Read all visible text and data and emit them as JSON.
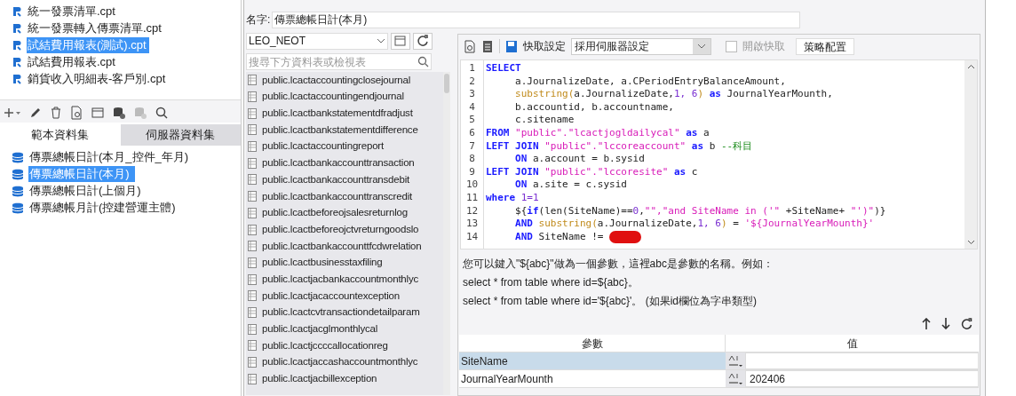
{
  "file_list": [
    {
      "label": "統一發票清單.cpt",
      "selected": false
    },
    {
      "label": "統一發票轉入傳票清單.cpt",
      "selected": false
    },
    {
      "label": "試結費用報表(測試).cpt",
      "selected": true
    },
    {
      "label": "試結費用報表.cpt",
      "selected": false
    },
    {
      "label": "銷貨收入明細表-客戶別.cpt",
      "selected": false
    }
  ],
  "dataset_tabs": [
    {
      "label": "範本資料集",
      "selected": true
    },
    {
      "label": "伺服器資料集",
      "selected": false
    }
  ],
  "datasets": [
    {
      "label": "傳票總帳日計(本月_控件_年月)",
      "selected": false
    },
    {
      "label": "傳票總帳日計(本月)",
      "selected": true
    },
    {
      "label": "傳票總帳日計(上個月)",
      "selected": false
    },
    {
      "label": "傳票總帳月計(控建營運主體)",
      "selected": false
    }
  ],
  "dialog": {
    "name_label": "名字:",
    "name_value": "傳票總帳日計(本月)",
    "connection": "LEO_NEOT",
    "search_placeholder": "搜尋下方資料表或檢視表",
    "tables": [
      "public.lcactaccountingclosejournal",
      "public.lcactaccountingendjournal",
      "public.lcactbankstatementdfradjust",
      "public.lcactbankstatementdifference",
      "public.lcactaccountingreport",
      "public.lcactbankaccounttransaction",
      "public.lcactbankaccounttransdebit",
      "public.lcactbankaccounttranscredit",
      "public.lcactbeforeojsalesreturnlog",
      "public.lcactbeforeojctvreturngoodslo",
      "public.lcactbankaccounttfcdwrelation",
      "public.lcactbusinesstaxfiling",
      "public.lcactjacbankaccountmonthlyc",
      "public.lcactjacaccountexception",
      "public.lcactcvtransactiondetailparam",
      "public.lcactjacglmonthlycal",
      "public.lcactjccccallocationreg",
      "public.lcactjaccashaccountmonthlyc",
      "public.lcactjacbillexception"
    ],
    "cache_label": "快取設定",
    "cache_value": "採用伺服器設定",
    "enable_cache": {
      "label": "開啟快取",
      "checked": false,
      "disabled": true
    },
    "strategy_button": "策略配置",
    "code_lines": [
      {
        "number": "1",
        "segments": [
          {
            "kind": "keyword",
            "text": "SELECT"
          }
        ]
      },
      {
        "number": "2",
        "segments": [
          {
            "kind": "plain",
            "text": "     a.JournalizeDate, a.CPeriodEntryBalanceAmount,"
          }
        ]
      },
      {
        "number": "3",
        "segments": [
          {
            "kind": "func",
            "text": "     substring("
          },
          {
            "kind": "plain",
            "text": "a.JournalizeDate,"
          },
          {
            "kind": "number",
            "text": "1, 6"
          },
          {
            "kind": "func",
            "text": ")"
          },
          {
            "kind": "keyword",
            "text": " as"
          },
          {
            "kind": "plain",
            "text": " JournalYearMounth,"
          }
        ]
      },
      {
        "number": "4",
        "segments": [
          {
            "kind": "plain",
            "text": "     b.accountid, b.accountname,"
          }
        ]
      },
      {
        "number": "5",
        "segments": [
          {
            "kind": "plain",
            "text": "     c.sitename"
          }
        ]
      },
      {
        "number": "6",
        "segments": [
          {
            "kind": "keyword",
            "text": "FROM"
          },
          {
            "kind": "string",
            "text": " \"public\".\"lcactjogldailycal\""
          },
          {
            "kind": "keyword",
            "text": " as"
          },
          {
            "kind": "plain",
            "text": " a"
          }
        ]
      },
      {
        "number": "7",
        "segments": [
          {
            "kind": "keyword",
            "text": "LEFT JOIN"
          },
          {
            "kind": "string",
            "text": " \"public\".\"lccoreaccount\""
          },
          {
            "kind": "keyword",
            "text": " as"
          },
          {
            "kind": "plain",
            "text": " b "
          },
          {
            "kind": "comment",
            "text": "--科目"
          }
        ]
      },
      {
        "number": "8",
        "segments": [
          {
            "kind": "keyword",
            "text": "     ON"
          },
          {
            "kind": "plain",
            "text": " a.account = b.sysid"
          }
        ]
      },
      {
        "number": "9",
        "segments": [
          {
            "kind": "keyword",
            "text": "LEFT JOIN"
          },
          {
            "kind": "string",
            "text": " \"public\".\"lccoresite\""
          },
          {
            "kind": "keyword",
            "text": " as"
          },
          {
            "kind": "plain",
            "text": " c"
          }
        ]
      },
      {
        "number": "10",
        "segments": [
          {
            "kind": "keyword",
            "text": "     ON"
          },
          {
            "kind": "plain",
            "text": " a.site = c.sysid"
          }
        ]
      },
      {
        "number": "11",
        "segments": [
          {
            "kind": "keyword",
            "text": "where"
          },
          {
            "kind": "number",
            "text": " 1=1"
          }
        ]
      },
      {
        "number": "12",
        "segments": [
          {
            "kind": "plain",
            "text": "     ${"
          },
          {
            "kind": "keyword",
            "text": "if"
          },
          {
            "kind": "plain",
            "text": "(len(SiteName)=="
          },
          {
            "kind": "number",
            "text": "0"
          },
          {
            "kind": "plain",
            "text": ","
          },
          {
            "kind": "string",
            "text": "\"\",\"and SiteName in ('\""
          },
          {
            "kind": "plain",
            "text": " +SiteName+ "
          },
          {
            "kind": "string",
            "text": "\"')\""
          },
          {
            "kind": "plain",
            "text": ")}"
          }
        ]
      },
      {
        "number": "13",
        "segments": [
          {
            "kind": "keyword",
            "text": "     AND"
          },
          {
            "kind": "func",
            "text": " substring("
          },
          {
            "kind": "plain",
            "text": "a.JournalizeDate,"
          },
          {
            "kind": "number",
            "text": "1, 6"
          },
          {
            "kind": "func",
            "text": ")"
          },
          {
            "kind": "plain",
            "text": " = "
          },
          {
            "kind": "string",
            "text": "'${JournalYearMounth}'"
          }
        ]
      },
      {
        "number": "14",
        "segments": [
          {
            "kind": "keyword",
            "text": "     AND"
          },
          {
            "kind": "plain",
            "text": " SiteName != "
          },
          {
            "kind": "redacted"
          }
        ]
      }
    ],
    "hint_lines": [
      "您可以鍵入\"${abc}\"做為一個參數，這裡abc是參數的名稱。例如：",
      "select * from table where id=${abc}。",
      "select * from table where id='${abc}'。 (如果id欄位為字串類型)"
    ],
    "param_columns": [
      "參數",
      "值"
    ],
    "params": [
      {
        "name": "SiteName",
        "selected": true
      },
      {
        "name": "JournalYearMounth",
        "value": "202406",
        "selected": false
      }
    ]
  }
}
